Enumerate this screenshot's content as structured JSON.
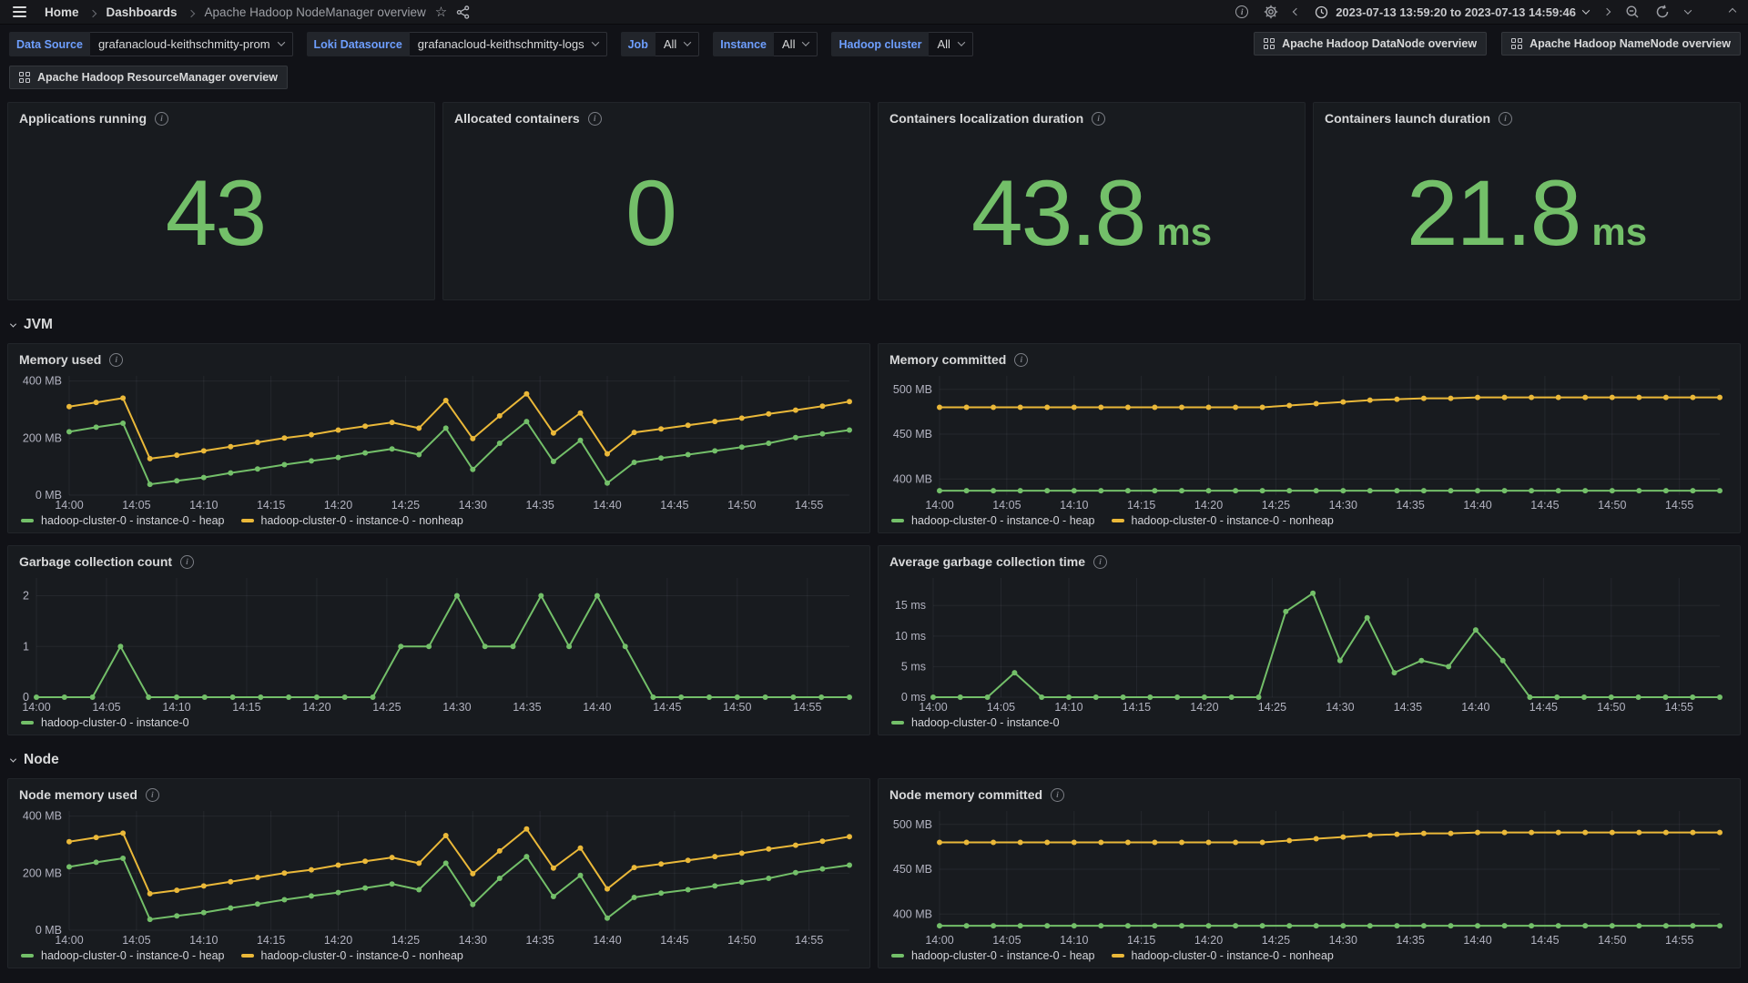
{
  "header": {
    "breadcrumb": {
      "home": "Home",
      "dashboards": "Dashboards",
      "current": "Apache Hadoop NodeManager overview"
    },
    "time_range": "2023-07-13 13:59:20 to 2023-07-13 14:59:46"
  },
  "icons": {
    "star": "☆"
  },
  "filters": [
    {
      "label": "Data Source",
      "value": "grafanacloud-keithschmitty-prom"
    },
    {
      "label": "Loki Datasource",
      "value": "grafanacloud-keithschmitty-logs"
    },
    {
      "label": "Job",
      "value": "All"
    },
    {
      "label": "Instance",
      "value": "All"
    },
    {
      "label": "Hadoop cluster",
      "value": "All"
    }
  ],
  "dashboard_links": [
    "Apache Hadoop DataNode overview",
    "Apache Hadoop NameNode overview",
    "Apache Hadoop ResourceManager overview"
  ],
  "stats": [
    {
      "title": "Applications running",
      "value": "43",
      "unit": ""
    },
    {
      "title": "Allocated containers",
      "value": "0",
      "unit": ""
    },
    {
      "title": "Containers localization duration",
      "value": "43.8",
      "unit": "ms"
    },
    {
      "title": "Containers launch duration",
      "value": "21.8",
      "unit": "ms"
    }
  ],
  "sections": [
    {
      "title": "JVM"
    },
    {
      "title": "Node"
    }
  ],
  "colors": {
    "green": "#73bf69",
    "yellow": "#eab839",
    "stat_green": "#73bf69"
  },
  "chart_data": [
    {
      "id": "memory_used",
      "type": "line",
      "title": "Memory used",
      "x_start_min": 0,
      "x_step_min": 2,
      "x_ticks": [
        "14:00",
        "14:05",
        "14:10",
        "14:15",
        "14:20",
        "14:25",
        "14:30",
        "14:35",
        "14:40",
        "14:45",
        "14:50",
        "14:55"
      ],
      "ylim": [
        0,
        418
      ],
      "yticks": [
        {
          "v": 0,
          "label": "0 MB"
        },
        {
          "v": 200,
          "label": "200 MB"
        },
        {
          "v": 400,
          "label": "400 MB"
        }
      ],
      "series": [
        {
          "name": "hadoop-cluster-0 - instance-0 - heap",
          "color": "#73bf69",
          "values": [
            222,
            238,
            252,
            38,
            50,
            62,
            78,
            92,
            107,
            120,
            132,
            148,
            162,
            142,
            235,
            90,
            182,
            258,
            118,
            192,
            42,
            115,
            130,
            142,
            155,
            168,
            182,
            202,
            215,
            228
          ]
        },
        {
          "name": "hadoop-cluster-0 - instance-0 - nonheap",
          "color": "#eab839",
          "values": [
            310,
            325,
            340,
            128,
            140,
            155,
            170,
            185,
            200,
            212,
            228,
            242,
            255,
            235,
            332,
            198,
            278,
            355,
            218,
            288,
            145,
            220,
            232,
            245,
            258,
            270,
            285,
            298,
            312,
            328
          ]
        }
      ]
    },
    {
      "id": "memory_committed",
      "type": "line",
      "title": "Memory committed",
      "x_start_min": 0,
      "x_step_min": 2,
      "x_ticks": [
        "14:00",
        "14:05",
        "14:10",
        "14:15",
        "14:20",
        "14:25",
        "14:30",
        "14:35",
        "14:40",
        "14:45",
        "14:50",
        "14:55"
      ],
      "ylim": [
        382,
        515
      ],
      "yticks": [
        {
          "v": 400,
          "label": "400 MB"
        },
        {
          "v": 450,
          "label": "450 MB"
        },
        {
          "v": 500,
          "label": "500 MB"
        }
      ],
      "series": [
        {
          "name": "hadoop-cluster-0 - instance-0 - heap",
          "color": "#73bf69",
          "values": [
            387,
            387,
            387,
            387,
            387,
            387,
            387,
            387,
            387,
            387,
            387,
            387,
            387,
            387,
            387,
            387,
            387,
            387,
            387,
            387,
            387,
            387,
            387,
            387,
            387,
            387,
            387,
            387,
            387,
            387
          ]
        },
        {
          "name": "hadoop-cluster-0 - instance-0 - nonheap",
          "color": "#eab839",
          "values": [
            480,
            480,
            480,
            480,
            480,
            480,
            480,
            480,
            480,
            480,
            480,
            480,
            480,
            482,
            484,
            486,
            488,
            489,
            490,
            490,
            491,
            491,
            491,
            491,
            491,
            491,
            491,
            491,
            491,
            491
          ]
        }
      ]
    },
    {
      "id": "gc_count",
      "type": "line",
      "title": "Garbage collection count",
      "x_start_min": 0,
      "x_step_min": 2,
      "x_ticks": [
        "14:00",
        "14:05",
        "14:10",
        "14:15",
        "14:20",
        "14:25",
        "14:30",
        "14:35",
        "14:40",
        "14:45",
        "14:50",
        "14:55"
      ],
      "ylim": [
        0,
        2.35
      ],
      "yticks": [
        {
          "v": 0,
          "label": "0"
        },
        {
          "v": 1,
          "label": "1"
        },
        {
          "v": 2,
          "label": "2"
        }
      ],
      "series": [
        {
          "name": "hadoop-cluster-0 - instance-0",
          "color": "#73bf69",
          "values": [
            0,
            0,
            0,
            1,
            0,
            0,
            0,
            0,
            0,
            0,
            0,
            0,
            0,
            1,
            1,
            2,
            1,
            1,
            2,
            1,
            2,
            1,
            0,
            0,
            0,
            0,
            0,
            0,
            0,
            0
          ]
        }
      ]
    },
    {
      "id": "gc_time",
      "type": "line",
      "title": "Average garbage collection time",
      "x_start_min": 0,
      "x_step_min": 2,
      "x_ticks": [
        "14:00",
        "14:05",
        "14:10",
        "14:15",
        "14:20",
        "14:25",
        "14:30",
        "14:35",
        "14:40",
        "14:45",
        "14:50",
        "14:55"
      ],
      "ylim": [
        0,
        19.5
      ],
      "yticks": [
        {
          "v": 0,
          "label": "0 ms"
        },
        {
          "v": 5,
          "label": "5 ms"
        },
        {
          "v": 10,
          "label": "10 ms"
        },
        {
          "v": 15,
          "label": "15 ms"
        }
      ],
      "series": [
        {
          "name": "hadoop-cluster-0 - instance-0",
          "color": "#73bf69",
          "values": [
            0,
            0,
            0,
            4,
            0,
            0,
            0,
            0,
            0,
            0,
            0,
            0,
            0,
            14,
            17,
            6,
            13,
            4,
            6,
            5,
            11,
            6,
            0,
            0,
            0,
            0,
            0,
            0,
            0,
            0
          ]
        }
      ]
    },
    {
      "id": "node_memory_used",
      "type": "line",
      "title": "Node memory used",
      "x_start_min": 0,
      "x_step_min": 2,
      "x_ticks": [
        "14:00",
        "14:05",
        "14:10",
        "14:15",
        "14:20",
        "14:25",
        "14:30",
        "14:35",
        "14:40",
        "14:45",
        "14:50",
        "14:55"
      ],
      "ylim": [
        0,
        418
      ],
      "yticks": [
        {
          "v": 0,
          "label": "0 MB"
        },
        {
          "v": 200,
          "label": "200 MB"
        },
        {
          "v": 400,
          "label": "400 MB"
        }
      ],
      "series": [
        {
          "name": "hadoop-cluster-0 - instance-0 - heap",
          "color": "#73bf69",
          "values": [
            222,
            238,
            252,
            38,
            50,
            62,
            78,
            92,
            107,
            120,
            132,
            148,
            162,
            142,
            235,
            90,
            182,
            258,
            118,
            192,
            42,
            115,
            130,
            142,
            155,
            168,
            182,
            202,
            215,
            228
          ]
        },
        {
          "name": "hadoop-cluster-0 - instance-0 - nonheap",
          "color": "#eab839",
          "values": [
            310,
            325,
            340,
            128,
            140,
            155,
            170,
            185,
            200,
            212,
            228,
            242,
            255,
            235,
            332,
            198,
            278,
            355,
            218,
            288,
            145,
            220,
            232,
            245,
            258,
            270,
            285,
            298,
            312,
            328
          ]
        }
      ]
    },
    {
      "id": "node_memory_committed",
      "type": "line",
      "title": "Node memory committed",
      "x_start_min": 0,
      "x_step_min": 2,
      "x_ticks": [
        "14:00",
        "14:05",
        "14:10",
        "14:15",
        "14:20",
        "14:25",
        "14:30",
        "14:35",
        "14:40",
        "14:45",
        "14:50",
        "14:55"
      ],
      "ylim": [
        382,
        515
      ],
      "yticks": [
        {
          "v": 400,
          "label": "400 MB"
        },
        {
          "v": 450,
          "label": "450 MB"
        },
        {
          "v": 500,
          "label": "500 MB"
        }
      ],
      "series": [
        {
          "name": "hadoop-cluster-0 - instance-0 - heap",
          "color": "#73bf69",
          "values": [
            387,
            387,
            387,
            387,
            387,
            387,
            387,
            387,
            387,
            387,
            387,
            387,
            387,
            387,
            387,
            387,
            387,
            387,
            387,
            387,
            387,
            387,
            387,
            387,
            387,
            387,
            387,
            387,
            387,
            387
          ]
        },
        {
          "name": "hadoop-cluster-0 - instance-0 - nonheap",
          "color": "#eab839",
          "values": [
            480,
            480,
            480,
            480,
            480,
            480,
            480,
            480,
            480,
            480,
            480,
            480,
            480,
            482,
            484,
            486,
            488,
            489,
            490,
            490,
            491,
            491,
            491,
            491,
            491,
            491,
            491,
            491,
            491,
            491
          ]
        }
      ]
    }
  ]
}
